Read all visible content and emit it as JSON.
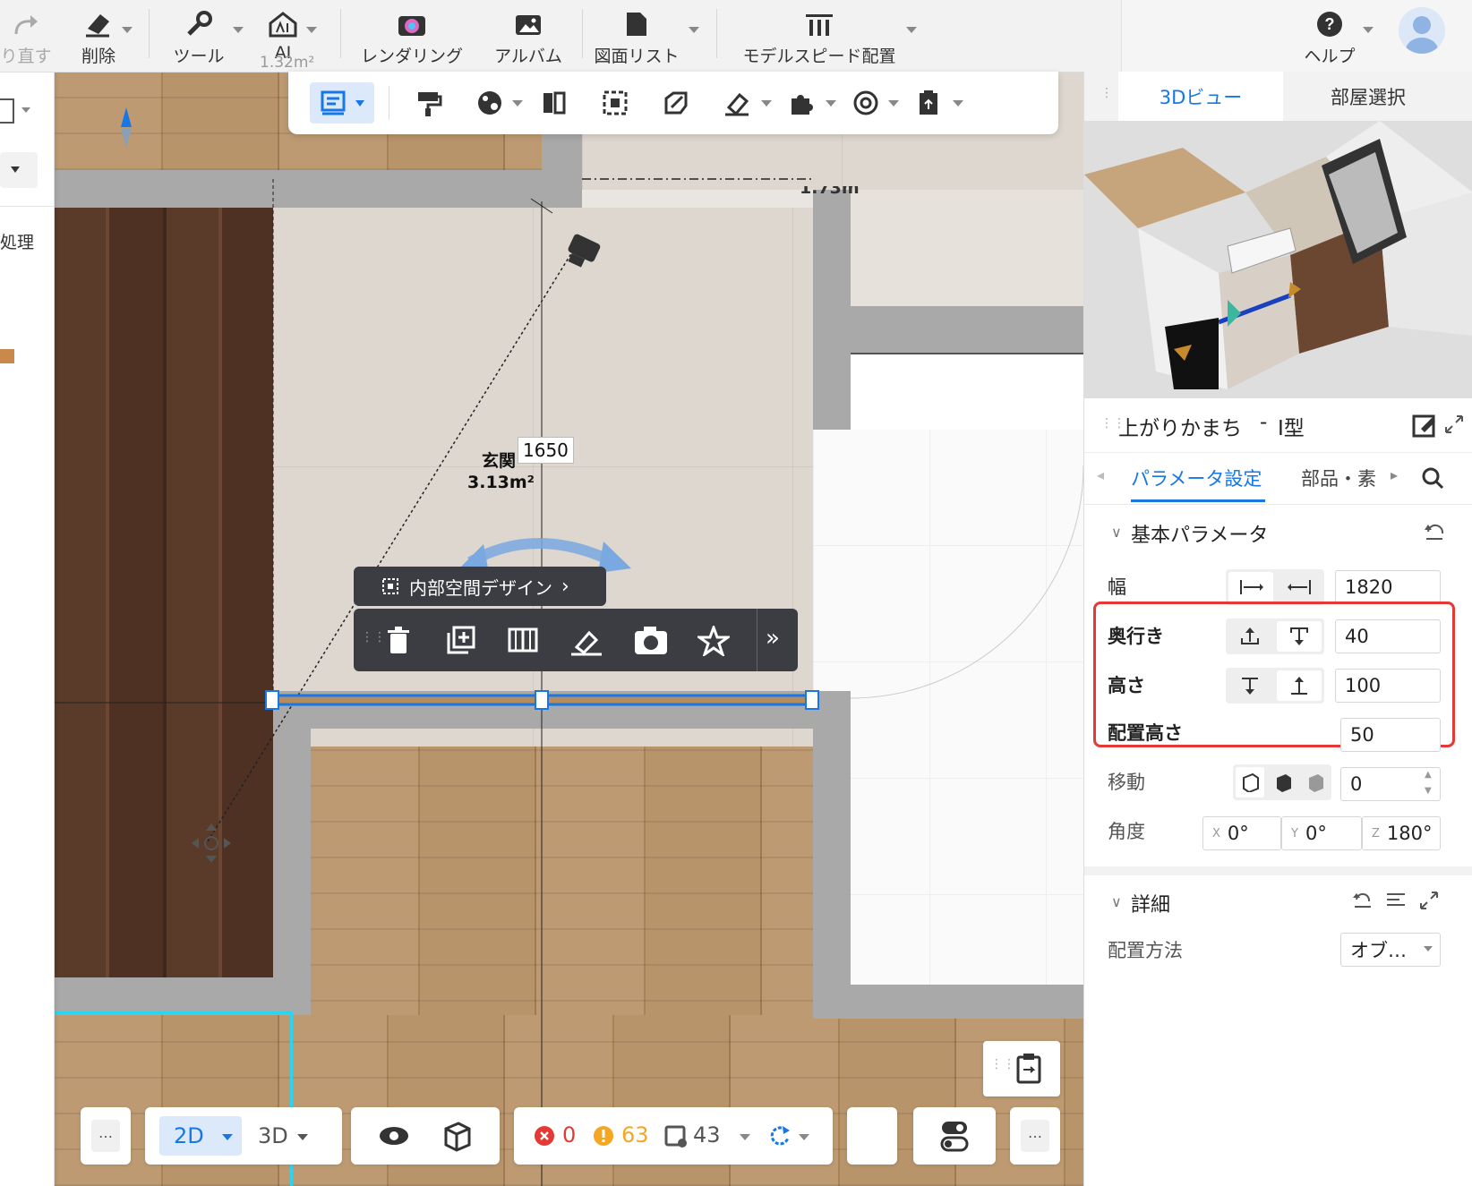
{
  "toolbar": {
    "redo_label": "り直す",
    "delete_label": "削除",
    "tools_label": "ツール",
    "ai_label": "AI",
    "ai_sub": "1.32m²",
    "rendering_label": "レンダリング",
    "album_label": "アルバム",
    "drawing_list_label": "図面リスト",
    "model_speed_label": "モデルスピード配置",
    "help_label": "ヘルプ"
  },
  "canvas": {
    "room_name": "玄関",
    "room_area": "3.13m²",
    "dimension": "1650",
    "top_dim_partial": "1.73m",
    "left_panel_text": "処理",
    "interior_design_label": "内部空間デザイン"
  },
  "right_panel": {
    "tab_3d": "3Dビュー",
    "tab_room": "部屋選択",
    "object_title": "上がりかまち",
    "object_type": "I型",
    "subtab_params": "パラメータ設定",
    "subtab_parts": "部品・素",
    "section_basic": "基本パラメータ",
    "width_label": "幅",
    "width_value": "1820",
    "depth_label": "奥行き",
    "depth_value": "40",
    "height_label": "高さ",
    "height_value": "100",
    "place_height_label": "配置高さ",
    "place_height_value": "50",
    "move_label": "移動",
    "move_value": "0",
    "angle_label": "角度",
    "angle_x_label": "X",
    "angle_x": "0°",
    "angle_y_label": "Y",
    "angle_y": "0°",
    "angle_z_label": "Z",
    "angle_z": "180°",
    "section_detail": "詳細",
    "placement_label": "配置方法",
    "placement_value": "オブ…"
  },
  "bottom": {
    "more1": "…",
    "mode_2d": "2D",
    "mode_3d": "3D",
    "errors": "0",
    "warnings": "63",
    "items": "43",
    "more2": "…"
  },
  "colors": {
    "accent": "#1677e5",
    "highlight": "#e53935",
    "error": "#e53935",
    "warning": "#f5a623"
  }
}
